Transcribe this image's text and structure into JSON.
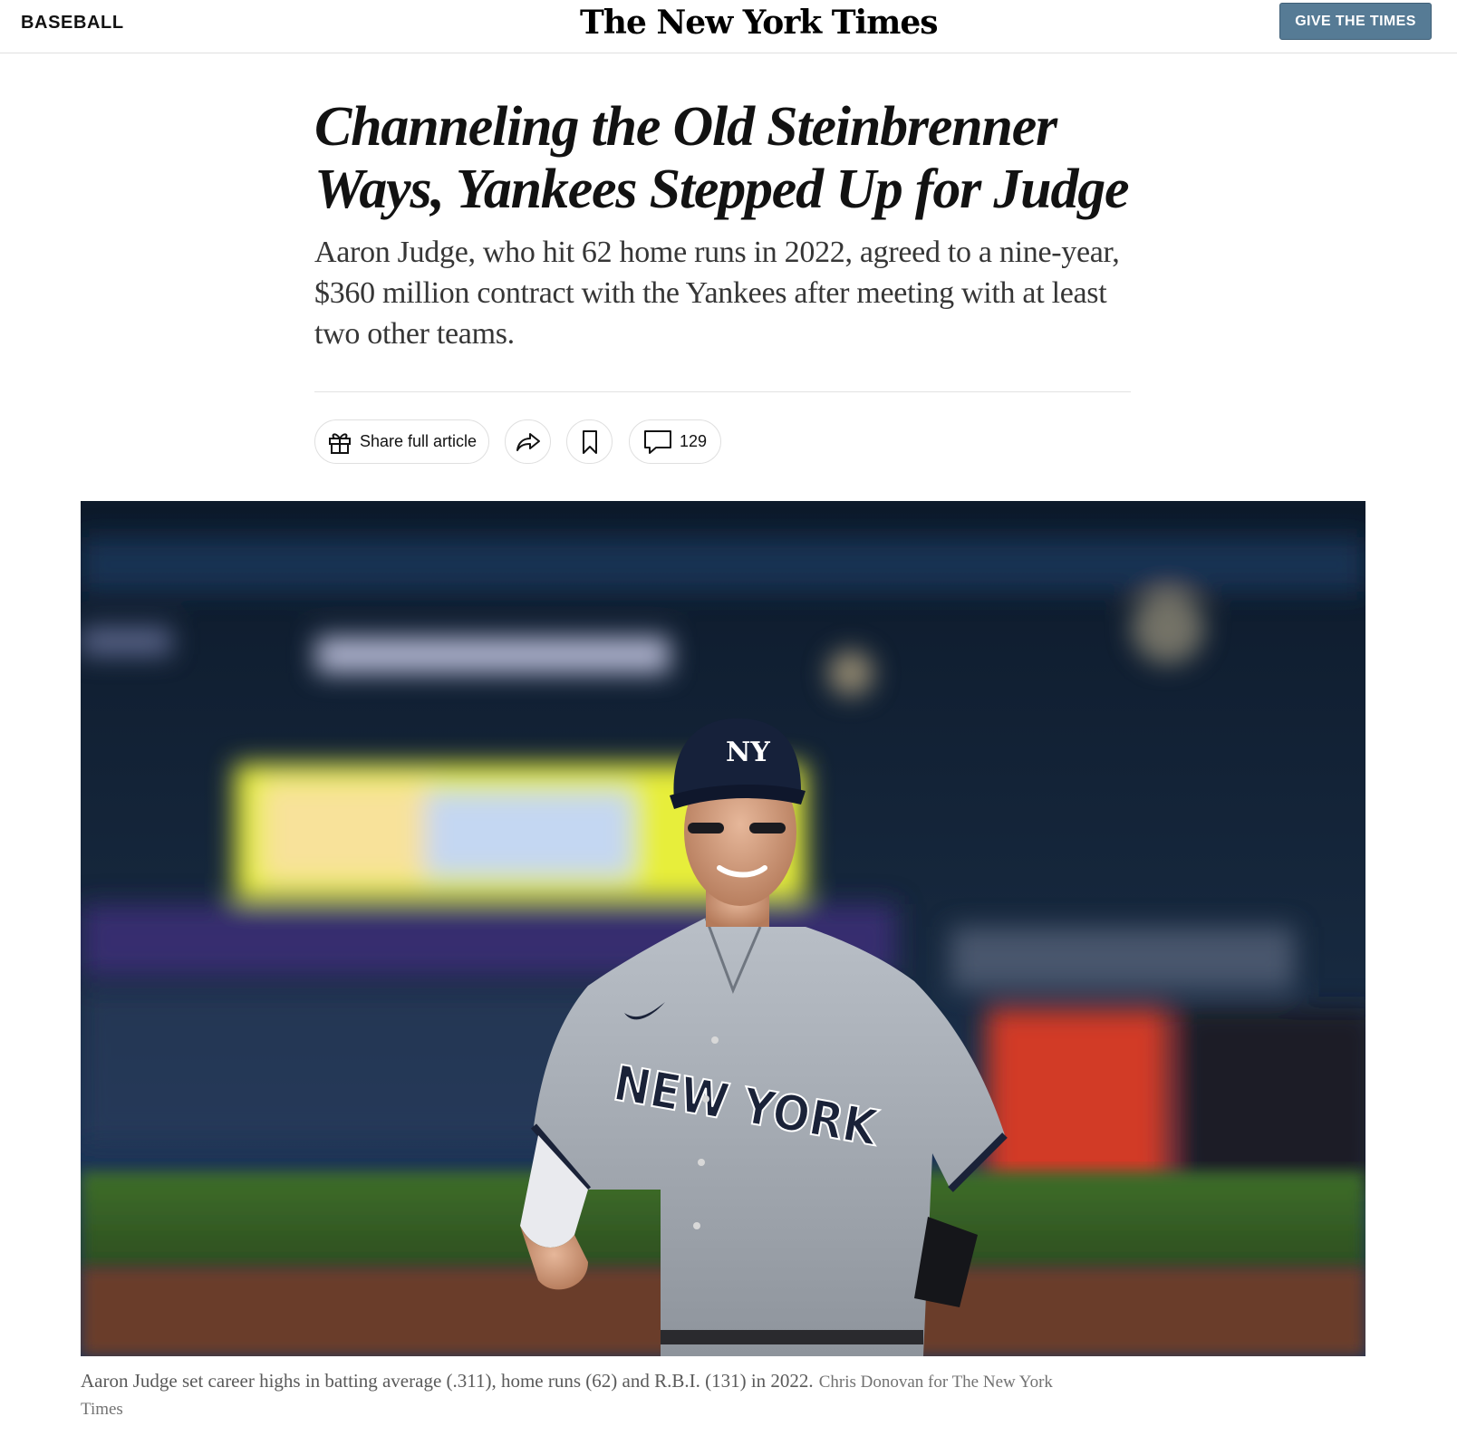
{
  "header": {
    "section": "BASEBALL",
    "logo": "The New York Times",
    "give_button": "GIVE THE TIMES"
  },
  "article": {
    "headline": "Channeling the Old Steinbrenner Ways, Yankees Stepped Up for Judge",
    "summary": "Aaron Judge, who hit 62 home runs in 2022, agreed to a nine-year, $360 million contract with the Yankees after meeting with at least two other teams."
  },
  "toolbar": {
    "share_label": "Share full article",
    "comment_count": "129",
    "icons": [
      "gift-icon",
      "share-arrow-icon",
      "bookmark-icon",
      "comment-icon"
    ]
  },
  "photo": {
    "cap_logo": "NY",
    "jersey_text": "NEW YORK"
  },
  "caption": {
    "text": "Aaron Judge set career highs in batting average (.311), home runs (62) and R.B.I. (131) in 2022.",
    "credit": "Chris Donovan for The New York Times"
  },
  "colors": {
    "give_button_bg": "#567b95",
    "headline": "#121212",
    "caption": "#5a5a5a"
  }
}
